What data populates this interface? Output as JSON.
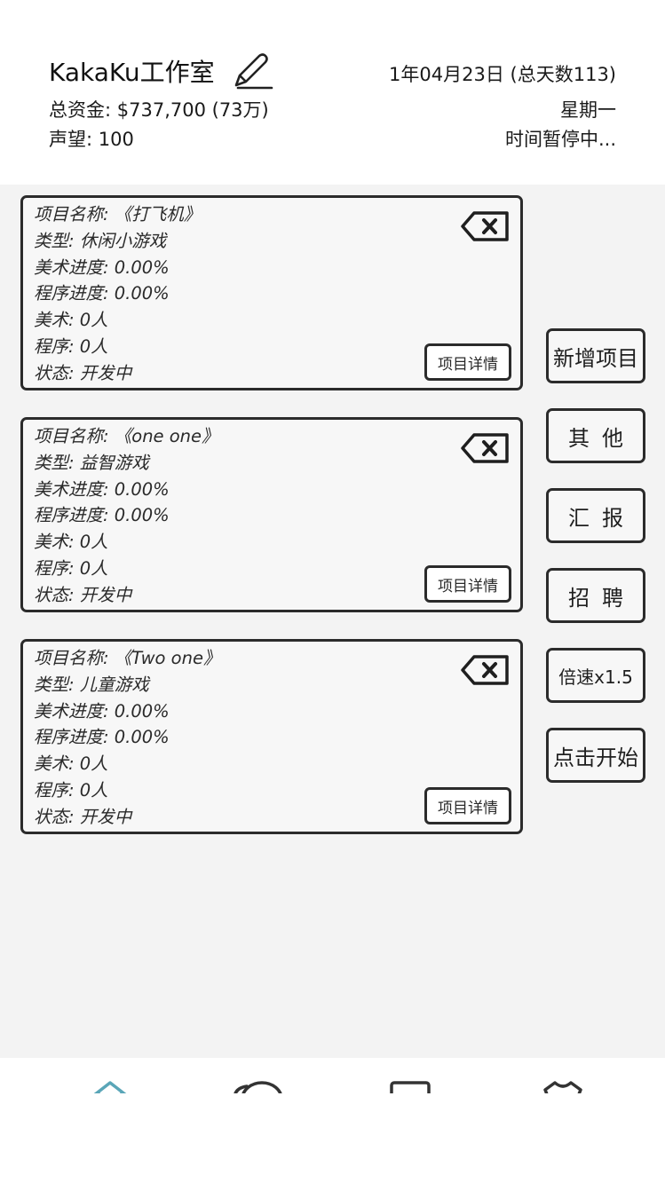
{
  "header": {
    "studio_name": "KakaKu工作室",
    "funds": "总资金: $737,700  (73万)",
    "reputation": "声望: 100",
    "date": "1年04月23日 (总天数113)",
    "weekday": "星期一",
    "time_status": "时间暂停中..."
  },
  "projects": [
    {
      "name": "项目名称: 《打飞机》",
      "type": "类型: 休闲小游戏",
      "art_progress": "美术进度: 0.00%",
      "code_progress": "程序进度: 0.00%",
      "artists": "美术: 0人",
      "programmers": "程序: 0人",
      "status": "状态: 开发中",
      "detail_label": "项目详情"
    },
    {
      "name": "项目名称: 《one one》",
      "type": "类型: 益智游戏",
      "art_progress": "美术进度: 0.00%",
      "code_progress": "程序进度: 0.00%",
      "artists": "美术: 0人",
      "programmers": "程序: 0人",
      "status": "状态: 开发中",
      "detail_label": "项目详情"
    },
    {
      "name": "项目名称: 《Two one》",
      "type": "类型: 儿童游戏",
      "art_progress": "美术进度: 0.00%",
      "code_progress": "程序进度: 0.00%",
      "artists": "美术: 0人",
      "programmers": "程序: 0人",
      "status": "状态: 开发中",
      "detail_label": "项目详情"
    }
  ],
  "side_buttons": {
    "new_project": "新增项目",
    "other": "其他",
    "report": "汇报",
    "recruit": "招聘",
    "speed": "倍速x1.5",
    "start": "点击开始"
  },
  "icons": {
    "edit": "pencil-icon",
    "delete": "backspace-delete-icon",
    "nav": [
      "home-icon",
      "chat-bubble-icon",
      "laptop-icon",
      "shirt-icon"
    ]
  },
  "colors": {
    "border": "#2b2b2b",
    "main_bg": "#f3f3f3",
    "nav_active": "#5aa6b8",
    "nav_inactive": "#333333"
  }
}
